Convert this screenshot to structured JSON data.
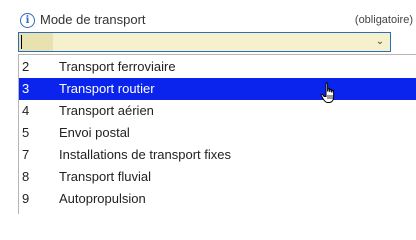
{
  "field": {
    "icon": "info-icon",
    "icon_glyph": "i",
    "label": "Mode de transport",
    "required_note": "(obligatoire)",
    "current_value": "",
    "arrow_glyph": "⌄",
    "accent_color": "#2f6db5",
    "input_bg_color": "#f4f1cc"
  },
  "dropdown": {
    "selected_color": "#0a24ee",
    "options": [
      {
        "code": "2",
        "label": "Transport ferroviaire",
        "selected": false
      },
      {
        "code": "3",
        "label": "Transport routier",
        "selected": true
      },
      {
        "code": "4",
        "label": "Transport aérien",
        "selected": false
      },
      {
        "code": "5",
        "label": "Envoi postal",
        "selected": false
      },
      {
        "code": "7",
        "label": "Installations de transport fixes",
        "selected": false
      },
      {
        "code": "8",
        "label": "Transport fluvial",
        "selected": false
      },
      {
        "code": "9",
        "label": "Autopropulsion",
        "selected": false
      }
    ]
  },
  "cursor": {
    "icon": "hand-pointer-icon"
  }
}
